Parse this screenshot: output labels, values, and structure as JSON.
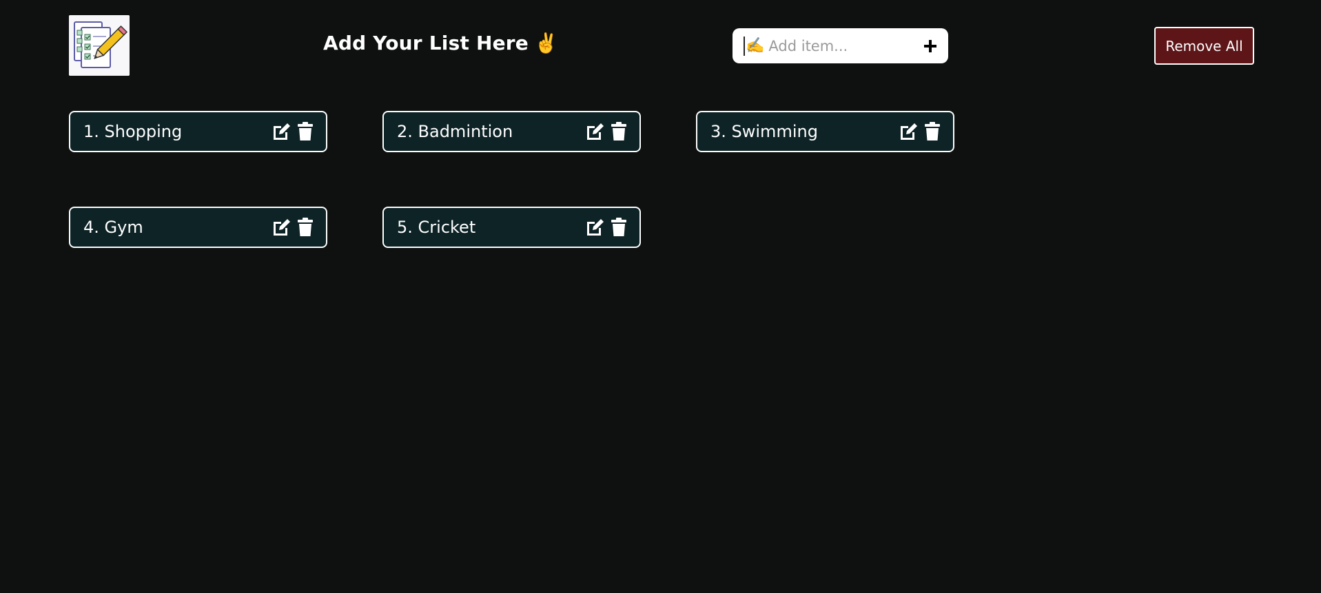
{
  "header": {
    "logo_icon": "checklist-with-pencil-icon",
    "title": "Add Your List Here",
    "title_emoji": "✌️"
  },
  "add_item": {
    "leading_icon": "writing-hand-icon",
    "leading_emoji": "✍️",
    "placeholder": "Add item...",
    "value": "",
    "add_icon": "plus-icon"
  },
  "remove_all": {
    "label": "Remove All",
    "color": "#5d1518"
  },
  "items": [
    {
      "label": "1. Shopping"
    },
    {
      "label": "2. Badmintion"
    },
    {
      "label": "3. Swimming"
    },
    {
      "label": "4. Gym"
    },
    {
      "label": "5. Cricket"
    }
  ],
  "item_actions": {
    "edit_icon": "edit-icon",
    "delete_icon": "trash-icon"
  },
  "colors": {
    "background": "#0f1111",
    "card_background": "#0e2326",
    "card_border": "#ffffff"
  }
}
